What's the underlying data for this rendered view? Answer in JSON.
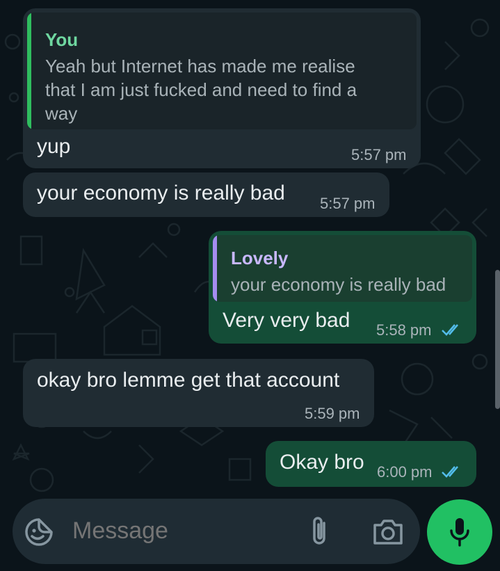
{
  "messages": [
    {
      "direction": "incoming",
      "reply": {
        "author": "You",
        "text_lines": [
          "Yeah but Internet has made me realise",
          "that I am just fucked and need to find a",
          "way"
        ]
      },
      "text": "yup",
      "time": "5:57 pm"
    },
    {
      "direction": "incoming",
      "text": "your economy is really bad",
      "time": "5:57 pm"
    },
    {
      "direction": "outgoing",
      "reply": {
        "author": "Lovely",
        "text": "your economy is really bad"
      },
      "text": "Very very bad",
      "time": "5:58 pm",
      "status": "read"
    },
    {
      "direction": "incoming",
      "text": "okay bro lemme get that account",
      "time": "5:59 pm"
    },
    {
      "direction": "outgoing",
      "text": "Okay bro",
      "time": "6:00 pm",
      "status": "read"
    }
  ],
  "composer": {
    "placeholder": "Message",
    "icons": {
      "sticker": "sticker-icon",
      "attach": "paperclip-icon",
      "camera": "camera-icon",
      "mic": "microphone-icon"
    }
  },
  "colors": {
    "background": "#0b141a",
    "incoming_bubble": "#202c33",
    "outgoing_bubble": "#144d37",
    "you_author": "#6fd7a0",
    "lovely_author": "#c8b8ff",
    "read_ticks": "#53bdeb",
    "mic_button": "#21c063"
  }
}
